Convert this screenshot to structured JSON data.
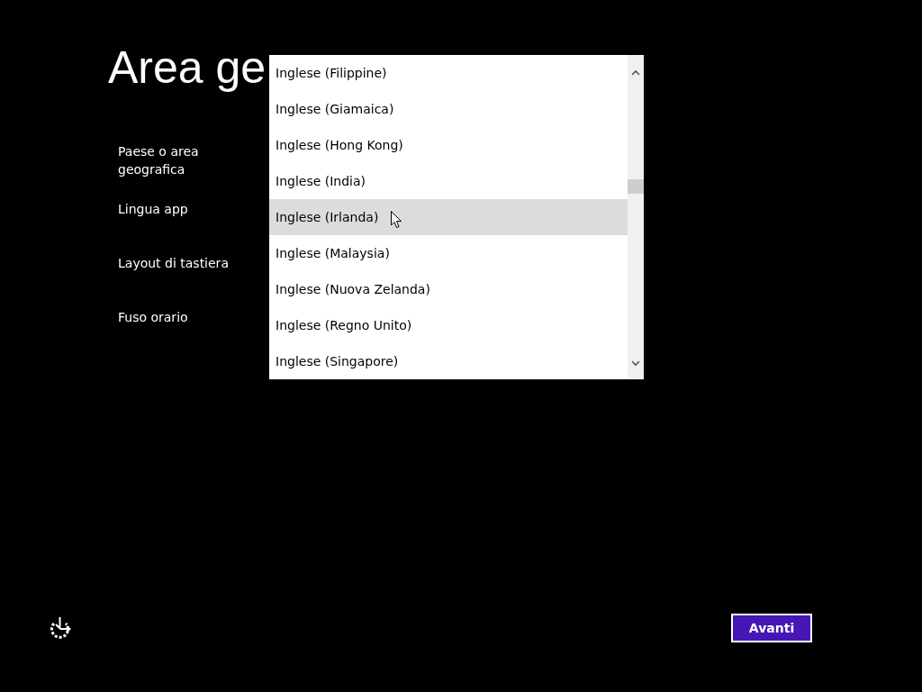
{
  "title": "Area ge",
  "fields": [
    {
      "label": "Paese o area geografica"
    },
    {
      "label": "Lingua app"
    },
    {
      "label": "Layout di tastiera"
    },
    {
      "label": "Fuso orario"
    }
  ],
  "dropdown": {
    "options": [
      {
        "label": "Inglese (Filippine)",
        "selected": false
      },
      {
        "label": "Inglese (Giamaica)",
        "selected": false
      },
      {
        "label": "Inglese (Hong Kong)",
        "selected": false
      },
      {
        "label": "Inglese (India)",
        "selected": false
      },
      {
        "label": "Inglese (Irlanda)",
        "selected": true
      },
      {
        "label": "Inglese (Malaysia)",
        "selected": false
      },
      {
        "label": "Inglese (Nuova Zelanda)",
        "selected": false
      },
      {
        "label": "Inglese (Regno Unito)",
        "selected": false
      },
      {
        "label": "Inglese (Singapore)",
        "selected": false
      }
    ]
  },
  "next_button": "Avanti"
}
